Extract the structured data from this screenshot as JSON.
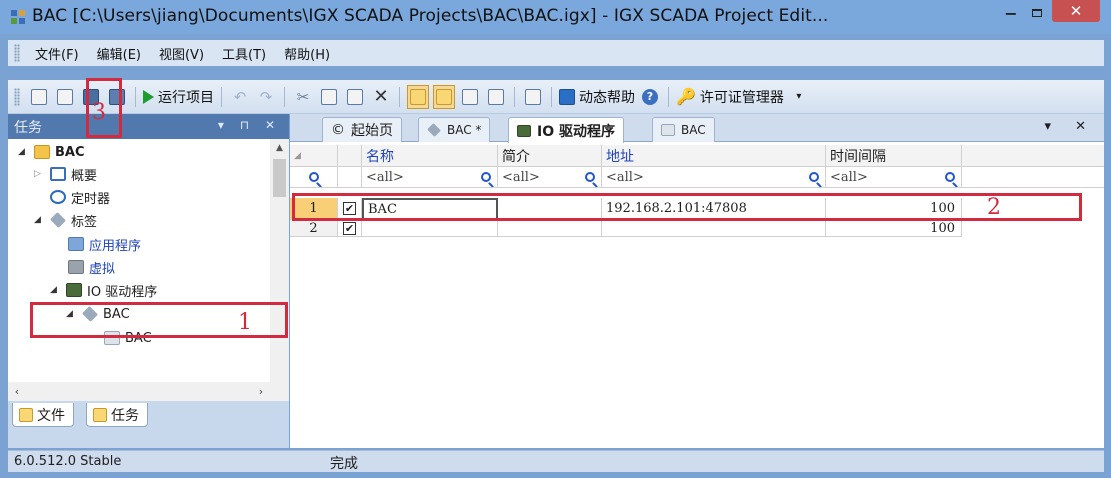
{
  "window": {
    "title": "BAC [C:\\Users\\jiang\\Documents\\IGX SCADA Projects\\BAC\\BAC.igx] - IGX SCADA Project Edit...",
    "min_glyph": "−",
    "close_glyph": "✕"
  },
  "menu": [
    "文件(F)",
    "编辑(E)",
    "视图(V)",
    "工具(T)",
    "帮助(H)"
  ],
  "toolbar": {
    "run_label": "运行项目",
    "dynamic_help_label": "动态帮助",
    "license_label": "许可证管理器",
    "cut_glyph": "✂",
    "delete_glyph": "✕",
    "undo_glyph": "↶",
    "redo_glyph": "↷",
    "help_glyph": "?",
    "key_glyph": "🔑",
    "more_glyph": "▾"
  },
  "left_panel": {
    "title": "任务",
    "controls": "▾ ⊓ ✕",
    "tree": [
      {
        "label": "BAC",
        "icon": "folder-icon"
      },
      {
        "label": "概要",
        "icon": "summary-icon"
      },
      {
        "label": "定时器",
        "icon": "clock-icon"
      },
      {
        "label": "标签",
        "icon": "tag-icon"
      },
      {
        "label": "应用程序",
        "icon": "app-icon"
      },
      {
        "label": "虚拟",
        "icon": "virtual-icon"
      },
      {
        "label": "IO 驱动程序",
        "icon": "io-driver-icon"
      },
      {
        "label": "BAC",
        "icon": "driver-icon"
      },
      {
        "label": "BAC",
        "icon": "device-icon"
      }
    ],
    "bottom_tabs": [
      "文件",
      "任务"
    ]
  },
  "editor": {
    "tabs": [
      {
        "label": "起始页",
        "icon": "start-page-icon"
      },
      {
        "label": "BAC *",
        "icon": "driver-icon"
      },
      {
        "label": "IO 驱动程序",
        "icon": "io-driver-icon"
      },
      {
        "label": "BAC",
        "icon": "device-icon"
      }
    ],
    "tab_controls": "▾ ✕",
    "columns": [
      "名称",
      "简介",
      "地址",
      "时间间隔"
    ],
    "filter": "<all>",
    "rows": [
      {
        "num": "1",
        "checked": "✔",
        "name": "BAC",
        "desc": "",
        "address": "192.168.2.101:47808",
        "interval": "100"
      },
      {
        "num": "2",
        "checked": "✔",
        "name": "",
        "desc": "",
        "address": "",
        "interval": "100"
      }
    ]
  },
  "status": {
    "version": "6.0.512.0 Stable",
    "message": "完成"
  },
  "annotations": {
    "one": "1",
    "two": "2",
    "three": "3"
  },
  "colors": {
    "annotation": "#d22b3f",
    "title_bar": "#7aa7dc",
    "selected_row": "#f8cf77"
  }
}
